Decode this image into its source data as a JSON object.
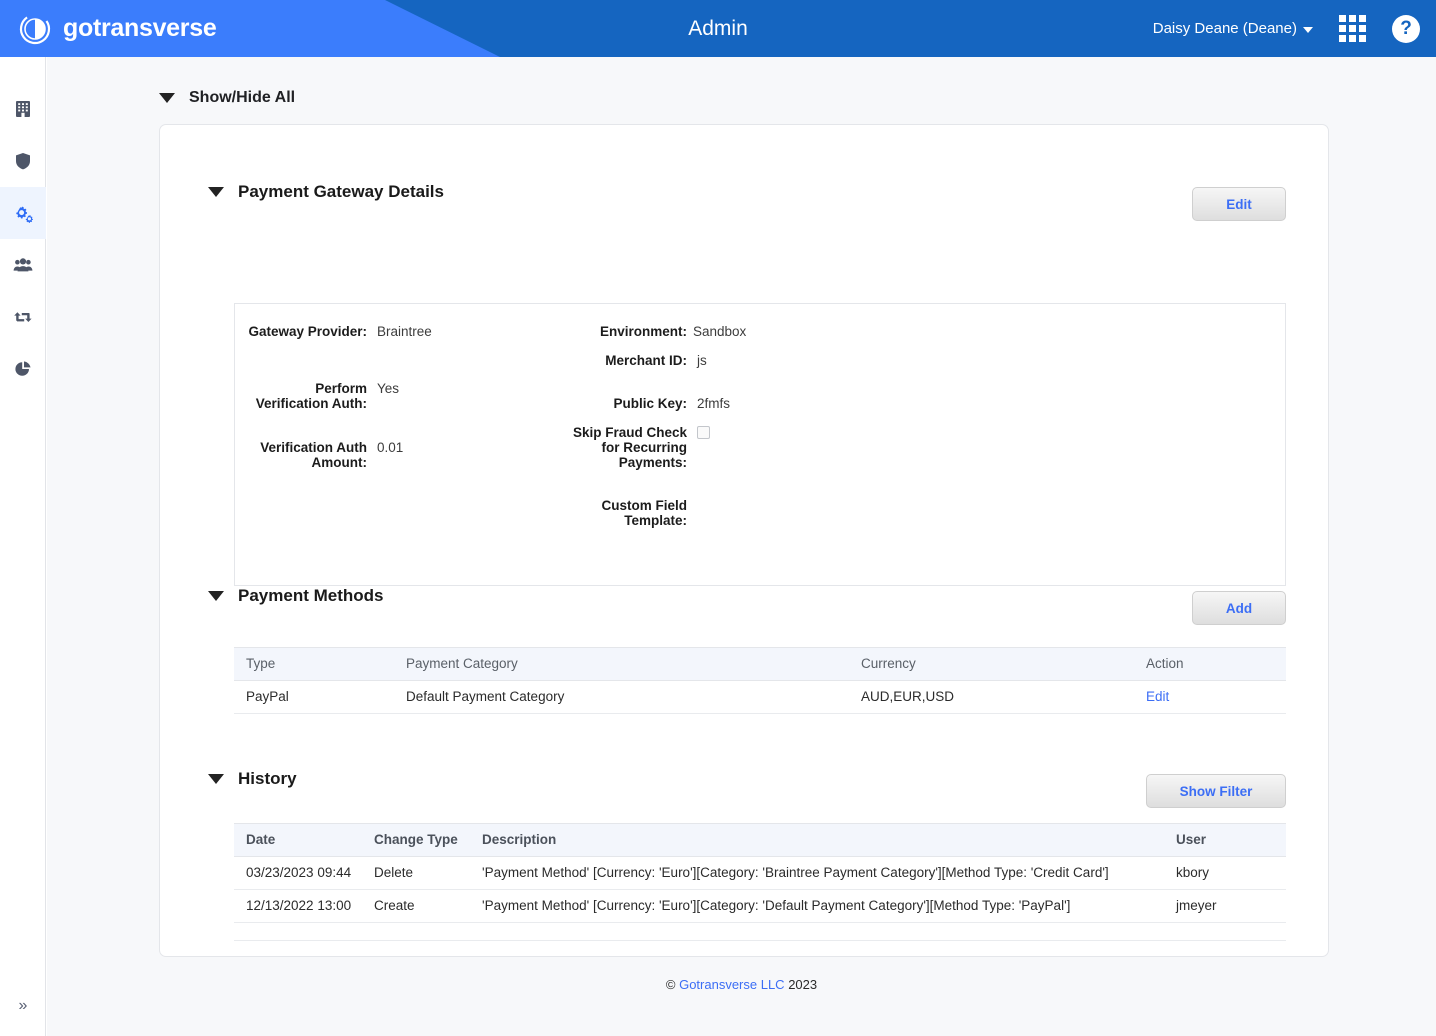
{
  "header": {
    "logo_text": "gotransverse",
    "title": "Admin",
    "user_name": "Daisy Deane (Deane)",
    "apps_icon": "grid-apps-icon",
    "help_icon": "help-question-icon",
    "brand_blue": "#1565c0",
    "accent_blue": "#3b7dfc"
  },
  "sidebar": {
    "items": [
      {
        "name": "sidebar-item-company",
        "icon": "building-icon",
        "active": false
      },
      {
        "name": "sidebar-item-security",
        "icon": "shield-icon",
        "active": false
      },
      {
        "name": "sidebar-item-settings",
        "icon": "gears-icon",
        "active": true
      },
      {
        "name": "sidebar-item-users",
        "icon": "users-icon",
        "active": false
      },
      {
        "name": "sidebar-item-transfers",
        "icon": "exchange-arrows-icon",
        "active": false
      },
      {
        "name": "sidebar-item-reports",
        "icon": "pie-chart-icon",
        "active": false
      }
    ],
    "expand_label": "»"
  },
  "show_hide": {
    "label": "Show/Hide All",
    "icon": "triangle-down-icon"
  },
  "gateway": {
    "section_title": "Payment Gateway Details",
    "edit_label": "Edit",
    "left_fields": [
      {
        "label": "Gateway Provider:",
        "value": "Braintree"
      },
      {
        "label": "Perform Verification Auth:",
        "value": "Yes"
      },
      {
        "label": "Verification Auth Amount:",
        "value": "0.01"
      }
    ],
    "right_fields": [
      {
        "label": "Environment:",
        "value": "Sandbox"
      },
      {
        "label": "Merchant ID:",
        "value": "js"
      },
      {
        "label": "Public Key:",
        "value": "2fmfs"
      },
      {
        "label": "Skip Fraud Check for Recurring Payments:",
        "value": "",
        "checkbox": true,
        "checked": false
      },
      {
        "label": "Custom Field Template:",
        "value": ""
      }
    ]
  },
  "payment_methods": {
    "section_title": "Payment Methods",
    "add_label": "Add",
    "columns": [
      "Type",
      "Payment Category",
      "Currency",
      "Action"
    ],
    "rows": [
      {
        "type": "PayPal",
        "category": "Default Payment Category",
        "currency": "AUD,EUR,USD",
        "action": "Edit"
      }
    ]
  },
  "history": {
    "section_title": "History",
    "filter_label": "Show Filter",
    "columns": [
      "Date",
      "Change Type",
      "Description",
      "User"
    ],
    "rows": [
      {
        "date": "03/23/2023 09:44",
        "change_type": "Delete",
        "description": "'Payment Method' [Currency: 'Euro'][Category: 'Braintree Payment Category'][Method Type: 'Credit Card']",
        "user": "kbory"
      },
      {
        "date": "12/13/2022 13:00",
        "change_type": "Create",
        "description": "'Payment Method' [Currency: 'Euro'][Category: 'Default Payment Category'][Method Type: 'PayPal']",
        "user": "jmeyer"
      }
    ]
  },
  "footer": {
    "copyright_symbol": "©",
    "link_text": "Gotransverse LLC",
    "year": "2023"
  }
}
